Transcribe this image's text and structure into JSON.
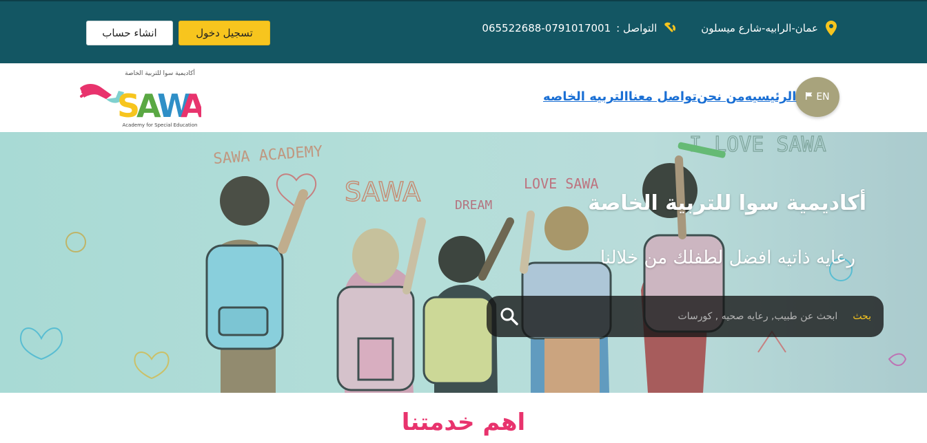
{
  "topbar": {
    "signup_label": "انشاء حساب",
    "login_label": "تسجيل دخول",
    "address": "عمان-الرابيه-شارع ميسلون",
    "contact_label": "التواصل :",
    "contact_phones": "065522688-0791017001"
  },
  "nav": {
    "lang_label": "EN",
    "links": [
      "الرئيسيه",
      "من نحن",
      "تواصل معنا",
      "التربيه الخاصه"
    ]
  },
  "logo": {
    "brand": "SAWA",
    "arabic_tagline": "أكاديمية سوا للتربية الخاصة",
    "english_tagline": "Academy for Special Education"
  },
  "hero": {
    "title": "أكاديمية سوا للتربية الخاصة",
    "subtitle": "رعايه ذاتيه افضل لطفلك من خلالنا",
    "search_button": "بحث",
    "search_placeholder": "ابحث عن طبيب, رعايه صحيه , كورسات",
    "wall_text": [
      "SAWA ACADEMY",
      "SAWA",
      "LOVE SAWA",
      "DREAM",
      "I LOVE SAWA"
    ]
  },
  "services": {
    "title": "اهم خدمتنا"
  },
  "colors": {
    "topbar_bg": "#135663",
    "accent_yellow": "#f7c51e",
    "link_blue": "#1a6fd4",
    "heading_pink": "#e8336d",
    "lang_badge": "#a8a37c"
  }
}
